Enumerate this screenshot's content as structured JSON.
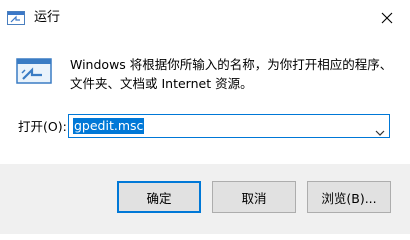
{
  "window": {
    "title": "运行",
    "icon": "run-app-icon",
    "close_icon": "close-icon"
  },
  "dialog": {
    "icon": "run-dialog-icon",
    "description_line1": "Windows 将根据你所输入的名称，为你打开相应的程序、",
    "description_line2": "文件夹、文档或 Internet 资源。"
  },
  "open": {
    "label": "打开(O):",
    "value": "gpedit.msc",
    "dropdown_icon": "chevron-down-icon"
  },
  "buttons": {
    "ok": "确定",
    "cancel": "取消",
    "browse": "浏览(B)..."
  },
  "colors": {
    "accent": "#0078d7",
    "footer_bg": "#f0f0f0",
    "button_bg": "#e1e1e1"
  }
}
